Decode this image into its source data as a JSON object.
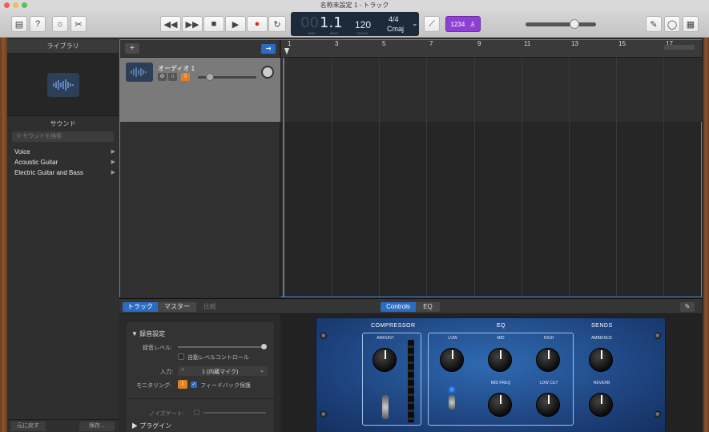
{
  "window": {
    "title": "名称未設定 1 - トラック"
  },
  "toolbar": {
    "lcd": {
      "bar_value": "00",
      "beat_value": "1.1",
      "bar_label": "BAR",
      "beat_label": "BEAT",
      "tempo": "120",
      "tempo_label": "TEMPO",
      "time_signature": "4/4",
      "key": "Cmaj"
    },
    "count_in": "1234"
  },
  "library": {
    "title": "ライブラリ",
    "section": "サウンド",
    "search_placeholder": "サウンドを検索",
    "items": [
      {
        "label": "Voice"
      },
      {
        "label": "Acoustic Guitar"
      },
      {
        "label": "Electric Guitar and Bass"
      }
    ],
    "revert_button": "元に戻す",
    "save_button": "保存..."
  },
  "tracks": {
    "add_label": "+",
    "track": {
      "name": "オーディオ 1"
    },
    "ruler": [
      "1",
      "3",
      "5",
      "7",
      "9",
      "11",
      "13",
      "15",
      "17"
    ]
  },
  "editor": {
    "tabs": [
      "トラック",
      "マスター",
      "比較"
    ],
    "view_tabs": [
      "Controls",
      "EQ"
    ],
    "recording_section": "録音設定",
    "rec_level_label": "録音レベル:",
    "auto_level_label": "自動レベルコントロール",
    "input_label": "入力:",
    "input_value": "1 (内蔵マイク)",
    "monitoring_label": "モニタリング:",
    "feedback_label": "フィードバック保護",
    "noise_gate_label": "ノイズゲート:",
    "plugins_label": "プラグイン",
    "amp": {
      "sections": [
        "COMPRESSOR",
        "EQ",
        "SENDS"
      ],
      "knobs": [
        "AMOUNT",
        "LOW",
        "MID",
        "HIGH",
        "AMBIENCE",
        "MID FREQ",
        "LOW CUT",
        "REVERB"
      ]
    }
  }
}
